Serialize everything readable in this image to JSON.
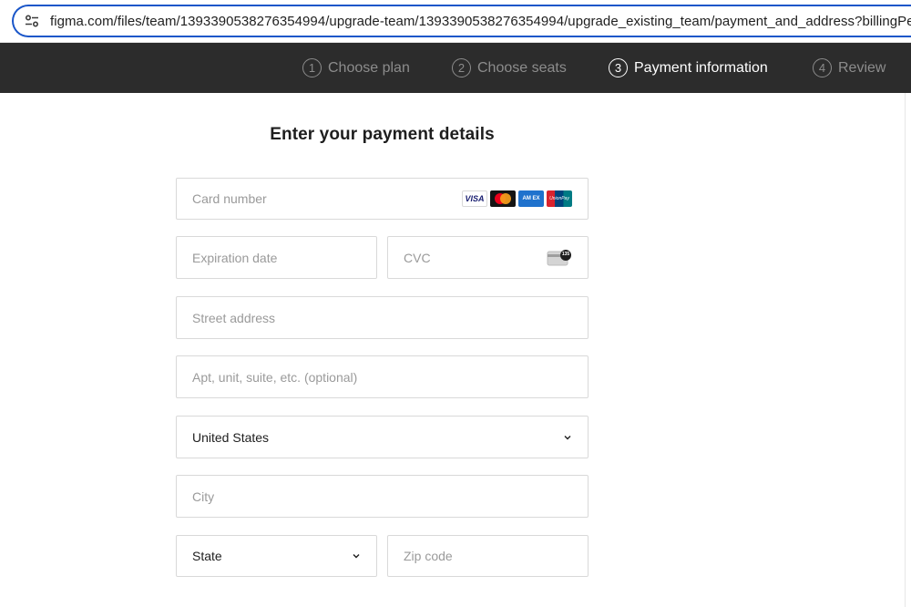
{
  "browser": {
    "url": "figma.com/files/team/1393390538276354994/upgrade-team/1393390538276354994/upgrade_existing_team/payment_and_address?billingPe"
  },
  "steps": [
    {
      "number": "1",
      "label": "Choose plan",
      "active": false
    },
    {
      "number": "2",
      "label": "Choose seats",
      "active": false
    },
    {
      "number": "3",
      "label": "Payment information",
      "active": true
    },
    {
      "number": "4",
      "label": "Review",
      "active": false
    }
  ],
  "form": {
    "title": "Enter your payment details",
    "card_number": {
      "placeholder": "Card number"
    },
    "card_brands": [
      "visa",
      "mastercard",
      "amex",
      "unionpay"
    ],
    "card_brand_labels": {
      "visa": "VISA",
      "amex": "AM EX",
      "unionpay": "UnionPay"
    },
    "expiration": {
      "placeholder": "Expiration date"
    },
    "cvc": {
      "placeholder": "CVC",
      "icon_label": "135"
    },
    "street": {
      "placeholder": "Street address"
    },
    "apt": {
      "placeholder": "Apt, unit, suite, etc. (optional)"
    },
    "country": {
      "value": "United States"
    },
    "city": {
      "placeholder": "City"
    },
    "state": {
      "value": "State"
    },
    "zip": {
      "placeholder": "Zip code"
    }
  },
  "colors": {
    "step_bar_bg": "#2c2c2c",
    "url_focus_border": "#1a56c9",
    "field_border": "#d9d9d9",
    "placeholder": "#9a9a9a"
  }
}
